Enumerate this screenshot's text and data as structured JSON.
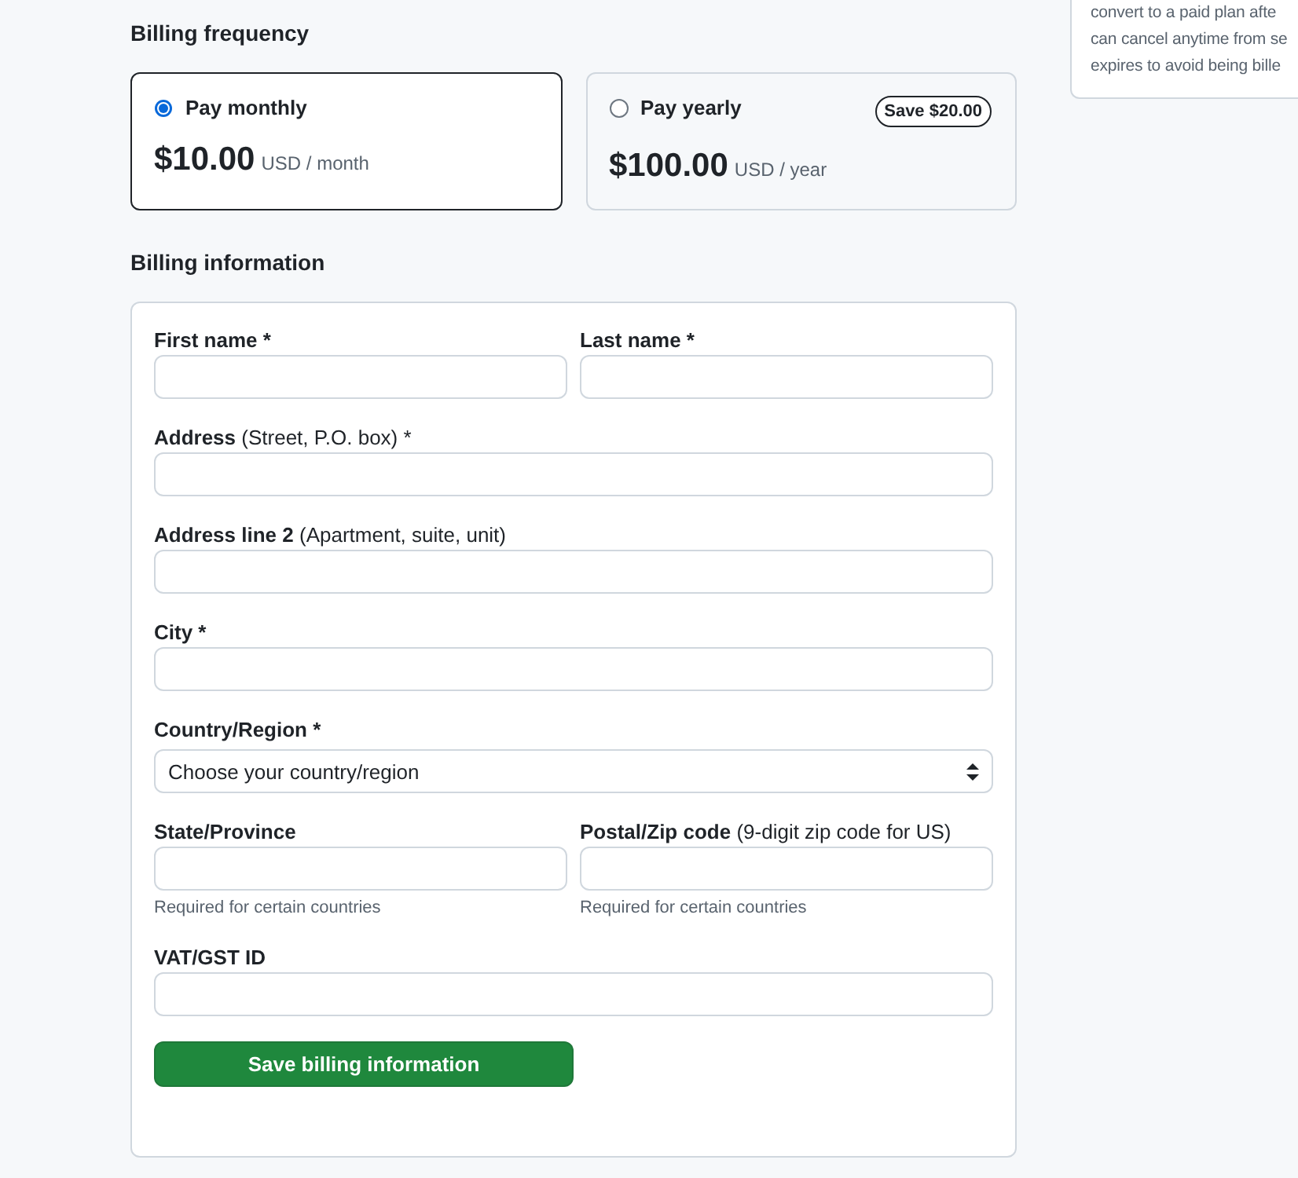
{
  "billing_frequency": {
    "title": "Billing frequency",
    "options": [
      {
        "label": "Pay monthly",
        "selected": true,
        "price": "$10.00",
        "unit": "USD / month"
      },
      {
        "label": "Pay yearly",
        "selected": false,
        "price": "$100.00",
        "unit": "USD / year",
        "badge": "Save $20.00"
      }
    ]
  },
  "billing_information": {
    "title": "Billing information",
    "rows": [
      [
        {
          "kind": "text",
          "label": "First name *"
        },
        {
          "kind": "text",
          "label": "Last name *"
        }
      ],
      [
        {
          "kind": "text",
          "label": "Address",
          "note": "(Street, P.O. box) *"
        }
      ],
      [
        {
          "kind": "text",
          "label": "Address line 2",
          "note": "(Apartment, suite, unit)"
        }
      ],
      [
        {
          "kind": "text",
          "label": "City *"
        }
      ],
      [
        {
          "kind": "select",
          "label": "Country/Region *",
          "value": "Choose your country/region"
        }
      ],
      [
        {
          "kind": "text",
          "label": "State/Province",
          "hint": "Required for certain countries"
        },
        {
          "kind": "text",
          "label": "Postal/Zip code",
          "note": "(9-digit zip code for US)",
          "hint": "Required for certain countries"
        }
      ],
      [
        {
          "kind": "text",
          "label": "VAT/GST ID"
        }
      ]
    ],
    "button": "Save billing information"
  },
  "trial_info": {
    "lines": [
      "convert to a paid plan afte",
      "can cancel anytime from se",
      "expires to avoid being bille"
    ]
  }
}
